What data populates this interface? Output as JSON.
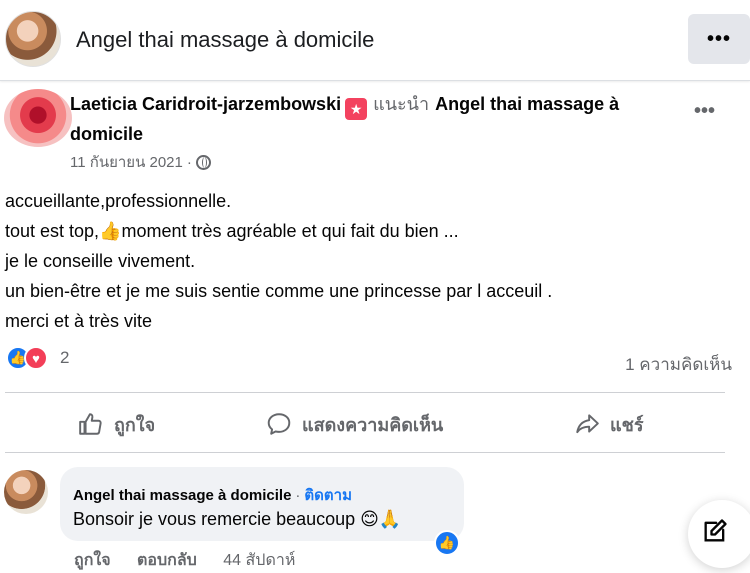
{
  "header": {
    "page_title": "Angel thai massage à domicile",
    "menu_label": "•••"
  },
  "post": {
    "author": "Laeticia Caridroit-jarzembowski",
    "recommends_word": "แนะนำ",
    "recommends_target": "Angel thai massage à domicile",
    "date": "11 กันยายน 2021",
    "date_separator": "·",
    "menu_label": "•••",
    "body_lines": [
      "accueillante,professionnelle.",
      "tout est top,",
      "moment très agréable et qui fait du bien ...",
      "je le conseille vivement.",
      "un bien-être et je me suis sentie comme une princesse par l acceuil .",
      "merci et à très vite"
    ],
    "thumb_emoji": "👍",
    "reaction_count": "2",
    "comment_count": "1 ความคิดเห็น"
  },
  "actions": {
    "like": "ถูกใจ",
    "comment": "แสดงความคิดเห็น",
    "share": "แชร์"
  },
  "comment": {
    "author": "Angel thai massage à domicile",
    "separator": "·",
    "follow": "ติดตาม",
    "text": "Bonsoir je vous remercie beaucoup 😊🙏",
    "like_action": "ถูกใจ",
    "reply_action": "ตอบกลับ",
    "time": "44 สัปดาห์"
  },
  "colors": {
    "accent": "#1877f2",
    "love": "#f33e58",
    "recommend": "#f3425f",
    "secondary_text": "#65676b",
    "bubble": "#f0f2f5"
  }
}
